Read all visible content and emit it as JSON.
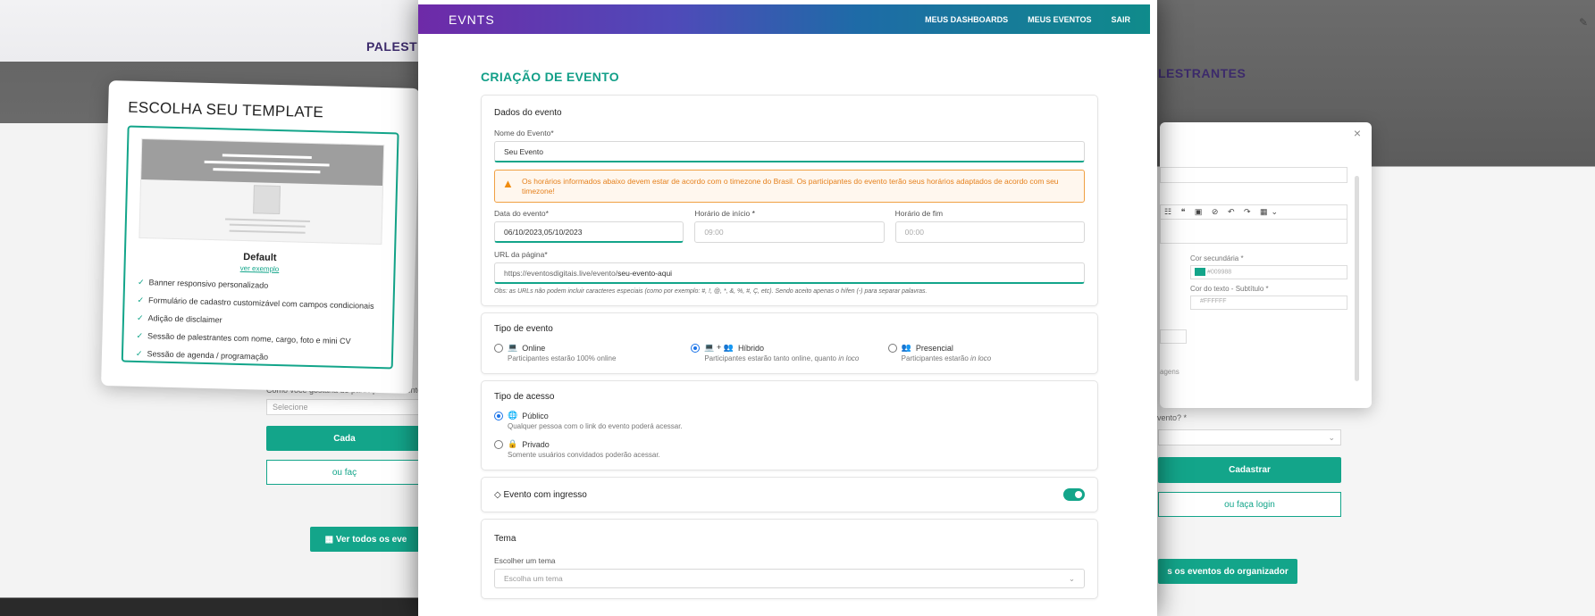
{
  "background": {
    "left_heading": "PALESTR",
    "left_participation_label": "Como você gostaria de participar do evento?",
    "left_select_placeholder": "Selecione",
    "left_register_button": "Cada",
    "left_login_button": "ou faç",
    "left_view_all_button": "Ver todos os eve",
    "right_heading": "LESTRANTES",
    "right_register_button": "Cadastrar",
    "right_login_button": "ou faça login",
    "right_view_all_button": "s os eventos do organizador",
    "right_event_label": "evento?",
    "right_pages_text": "agens",
    "right_secondary_color_label": "Cor secundária",
    "right_secondary_color_value": "#009988",
    "right_text_color_label": "Cor do texto - Subtítulo",
    "right_text_color_value": "#FFFFFF"
  },
  "template_picker": {
    "title": "ESCOLHA SEU TEMPLATE",
    "template_name": "Default",
    "example_link": "ver exemplo",
    "features": [
      "Banner responsivo personalizado",
      "Formulário de cadastro customizável com campos condicionais",
      "Adição de disclaimer",
      "Sessão de palestrantes com nome, cargo, foto e mini CV",
      "Sessão de agenda / programação"
    ]
  },
  "nav": {
    "logo": "EVNTS",
    "links": [
      "MEUS DASHBOARDS",
      "MEUS EVENTOS",
      "SAIR"
    ]
  },
  "page_title": "CRIAÇÃO DE EVENTO",
  "event_data": {
    "title": "Dados do evento",
    "name_label": "Nome do Evento*",
    "name_value": "Seu Evento",
    "alert": "Os horários informados abaixo devem estar de acordo com o timezone do Brasil. Os participantes do evento terão seus horários adaptados de acordo com seu timezone!",
    "date_label": "Data do evento*",
    "date_value": "06/10/2023,05/10/2023",
    "start_label": "Horário de início",
    "start_value": "09:00",
    "end_label": "Horário de fim",
    "end_value": "00:00",
    "url_label": "URL da página*",
    "url_prefix": "https://eventosdigitais.live/evento/",
    "url_slug": "seu-evento-aqui",
    "url_hint": "Obs: as URLs não podem incluir caracteres especiais (como por exemplo: #, !, @, *, &, %, #, Ç, etc). Sendo aceito apenas o hífen (-) para separar palavras."
  },
  "event_type": {
    "title": "Tipo de evento",
    "options": [
      {
        "icon": "💻",
        "label": "Online",
        "sub": "Participantes estarão 100% online",
        "selected": false
      },
      {
        "icon": "💻 + 👥",
        "label": "Híbrido",
        "sub_a": "Participantes estarão tanto online, quanto",
        "sub_em": "in loco",
        "selected": true
      },
      {
        "icon": "👥",
        "label": "Presencial",
        "sub_a": "Participantes estarão",
        "sub_em": "in loco",
        "selected": false
      }
    ]
  },
  "access_type": {
    "title": "Tipo de acesso",
    "options": [
      {
        "icon": "🌐",
        "label": "Público",
        "sub": "Qualquer pessoa com o link do evento poderá acessar.",
        "selected": true
      },
      {
        "icon": "🔒",
        "label": "Privado",
        "sub": "Somente usuários convidados poderão acessar.",
        "selected": false
      }
    ]
  },
  "ticket": {
    "icon": "◇",
    "label": "Evento com ingresso",
    "enabled": true
  },
  "theme": {
    "title": "Tema",
    "label": "Escolher um tema",
    "placeholder": "Escolha um tema"
  },
  "colors": {
    "accent": "#13a58a",
    "nav_gradient_start": "#6e2aa8",
    "nav_gradient_end": "#0f8b8b",
    "warning": "#f08c10"
  }
}
